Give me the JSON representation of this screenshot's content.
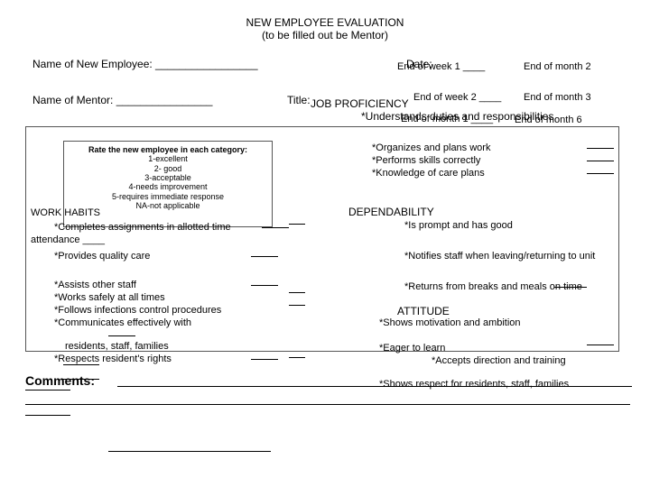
{
  "title": {
    "main": "NEW EMPLOYEE EVALUATION",
    "sub": "(to be filled out be Mentor)"
  },
  "labels": {
    "newEmployee": "Name of New Employee: _________________",
    "date": "Date:",
    "mentor": "Name of Mentor: ________________",
    "title": "Title:",
    "ew1": "End of week 1 ____",
    "em2": "End of month 2",
    "ew2": "End of week 2 ____",
    "em3": "End of month 3",
    "em1": "End of month 1 ____",
    "em6": "End of month 6"
  },
  "rating": {
    "head": "Rate the new employee in each category:",
    "r1": "1-excellent",
    "r2": "2- good",
    "r3": "3-acceptable",
    "r4": "4-needs improvement",
    "r5": "5-requires immediate response",
    "r6": "NA-not applicable"
  },
  "left": {
    "wh": "WORK HABITS",
    "ca": "*Completes assignments in allotted time",
    "att": "attendance  ____",
    "pq": "*Provides quality care",
    "ao": "*Assists other staff",
    "ws": "*Works safely at all times",
    "fi": "*Follows infections control procedures",
    "ce": "*Communicates effectively with",
    "rsf": "residents,  staff,  families",
    "rrr": "*Respects resident's rights"
  },
  "right": {
    "jp": "JOB PROFICIENCY",
    "ud": "*Understands duties and responsibilities",
    "org": "*Organizes and plans work",
    "psk": "*Performs skills correctly",
    "koc": "*Knowledge of care plans",
    "dep": "DEPENDABILITY",
    "prm": "*Is prompt and has good",
    "ns": "*Notifies staff when leaving/returning to unit",
    "ret": "*Returns from breaks and meals on time",
    "att": "ATTITUDE",
    "mot": "*Shows motivation and ambition",
    "eag": "*Eager to learn",
    "acc": "*Accepts direction and training",
    "resp": "*Shows respect for residents, staff, families"
  },
  "comments": "Comments:"
}
